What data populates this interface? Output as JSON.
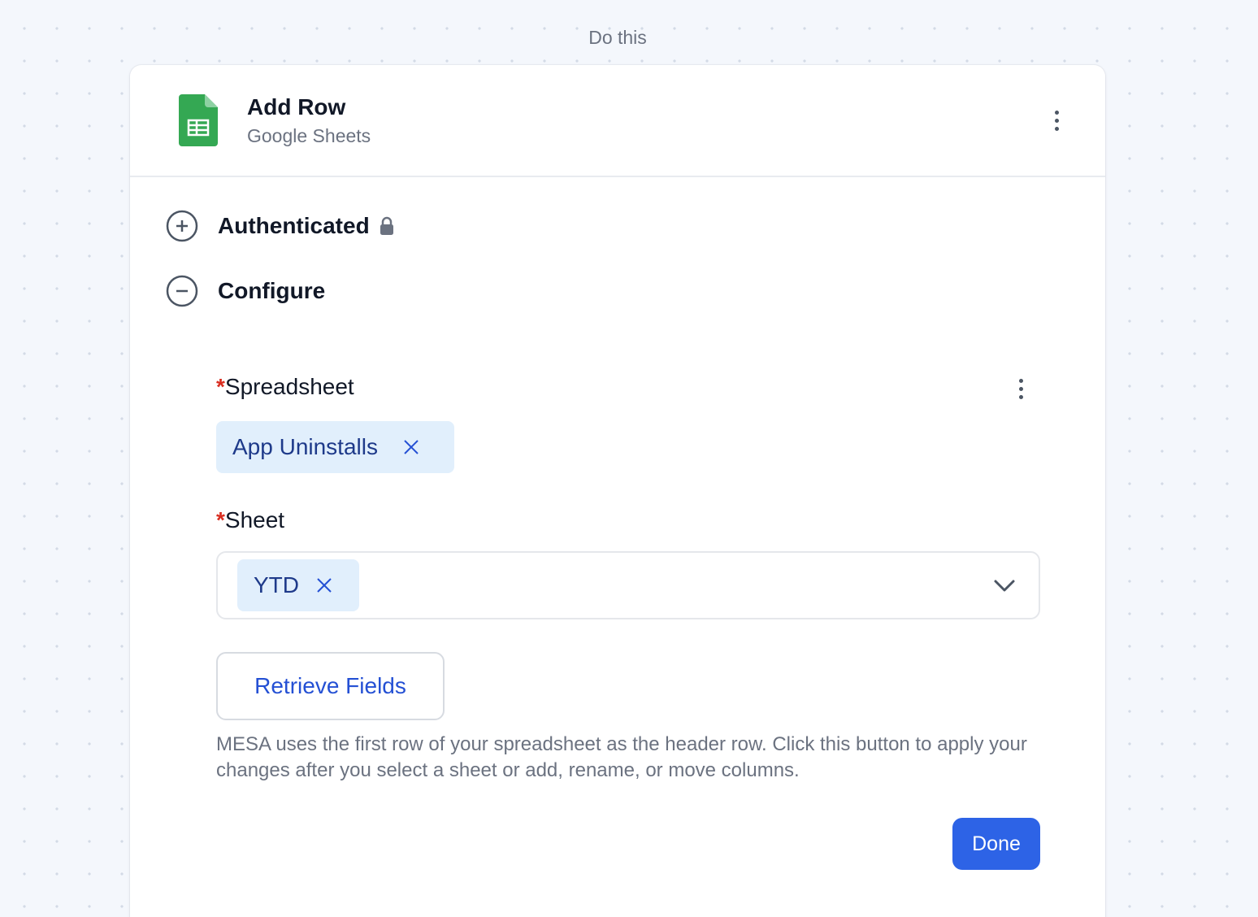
{
  "step_label": "Do this",
  "header": {
    "title": "Add Row",
    "subtitle": "Google Sheets",
    "icon": "google-sheets-icon"
  },
  "sections": {
    "authenticated": {
      "label": "Authenticated",
      "state": "collapsed",
      "icon": "plus-circle-icon"
    },
    "configure": {
      "label": "Configure",
      "state": "expanded",
      "icon": "minus-circle-icon"
    }
  },
  "fields": {
    "spreadsheet": {
      "required_mark": "*",
      "label": "Spreadsheet",
      "value": "App Uninstalls"
    },
    "sheet": {
      "required_mark": "*",
      "label": "Sheet",
      "value": "YTD"
    }
  },
  "retrieve_label": "Retrieve Fields",
  "help_text": "MESA uses the first row of your spreadsheet as the header row. Click this button to apply your changes after you select a sheet or add, rename, or move columns.",
  "done_label": "Done",
  "colors": {
    "accent": "#2d63e6",
    "link": "#2450d4",
    "chip_bg": "#e1effc",
    "chip_text": "#1e3a8a",
    "required": "#d92d20",
    "sheets_green": "#34a853"
  }
}
